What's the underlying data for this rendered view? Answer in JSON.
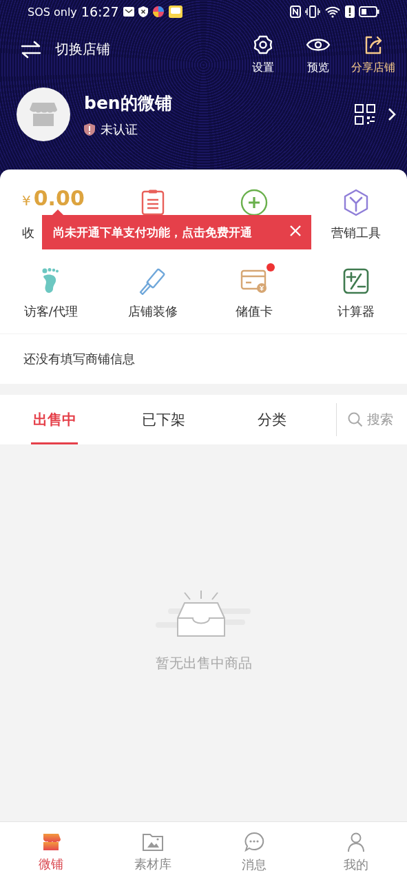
{
  "status_bar": {
    "carrier": "SOS only",
    "time": "16:27"
  },
  "header": {
    "switch_label": "切换店铺",
    "actions": [
      {
        "label": "设置",
        "kind": "settings",
        "highlighted": false
      },
      {
        "label": "预览",
        "kind": "preview",
        "highlighted": false
      },
      {
        "label": "分享店铺",
        "kind": "share",
        "highlighted": true
      }
    ]
  },
  "store": {
    "name": "ben的微铺",
    "status": "未认证"
  },
  "tools": [
    {
      "kind": "income",
      "currency": "¥",
      "amount": "0.00",
      "label": "收"
    },
    {
      "kind": "orders"
    },
    {
      "kind": "add"
    },
    {
      "kind": "marketing",
      "label": "营销工具"
    },
    {
      "kind": "visitors",
      "label": "访客/代理"
    },
    {
      "kind": "decorate",
      "label": "店铺装修"
    },
    {
      "kind": "card",
      "label": "储值卡",
      "badge": true
    },
    {
      "kind": "calculator",
      "label": "计算器"
    }
  ],
  "tooltip": {
    "text": "尚未开通下单支付功能，点击免费开通"
  },
  "notice": "还没有填写商铺信息",
  "tabs": [
    {
      "label": "出售中",
      "selected": true
    },
    {
      "label": "已下架",
      "selected": false
    },
    {
      "label": "分类",
      "selected": false
    }
  ],
  "search": {
    "label": "搜索"
  },
  "empty_state": "暂无出售中商品",
  "bottom_nav": [
    {
      "label": "微铺",
      "kind": "shop",
      "selected": true
    },
    {
      "label": "素材库",
      "kind": "gallery",
      "selected": false
    },
    {
      "label": "消息",
      "kind": "messages",
      "selected": false
    },
    {
      "label": "我的",
      "kind": "profile",
      "selected": false
    }
  ]
}
